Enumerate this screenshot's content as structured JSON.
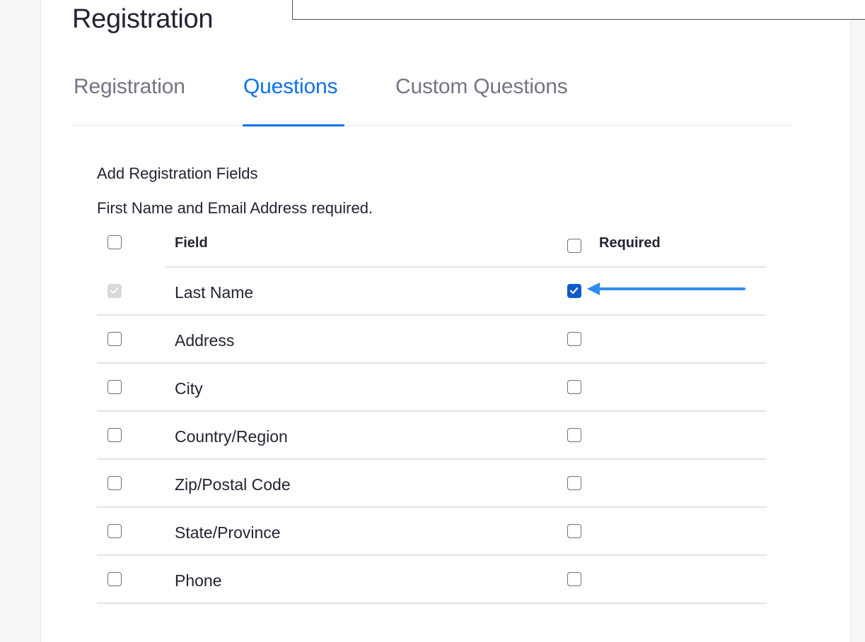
{
  "header": {
    "title": "Registration"
  },
  "tabs": [
    {
      "label": "Registration",
      "active": false
    },
    {
      "label": "Questions",
      "active": true
    },
    {
      "label": "Custom Questions",
      "active": false
    }
  ],
  "section": {
    "heading": "Add Registration Fields",
    "note": "First Name and Email Address required."
  },
  "table": {
    "columns": {
      "field": "Field",
      "required": "Required"
    },
    "rows": [
      {
        "label": "Last Name",
        "selected": true,
        "selected_disabled": true,
        "required": true
      },
      {
        "label": "Address",
        "selected": false,
        "selected_disabled": false,
        "required": false
      },
      {
        "label": "City",
        "selected": false,
        "selected_disabled": false,
        "required": false
      },
      {
        "label": "Country/Region",
        "selected": false,
        "selected_disabled": false,
        "required": false
      },
      {
        "label": "Zip/Postal Code",
        "selected": false,
        "selected_disabled": false,
        "required": false
      },
      {
        "label": "State/Province",
        "selected": false,
        "selected_disabled": false,
        "required": false
      },
      {
        "label": "Phone",
        "selected": false,
        "selected_disabled": false,
        "required": false
      }
    ]
  },
  "colors": {
    "accent": "#0e72ed",
    "checkbox_checked": "#0e5ac8",
    "annotation_arrow": "#2d8cf0",
    "text": "#232333",
    "tab_inactive": "#747487"
  },
  "icons": {
    "checkbox_check": "check-icon",
    "annotation": "arrow-left-icon"
  }
}
